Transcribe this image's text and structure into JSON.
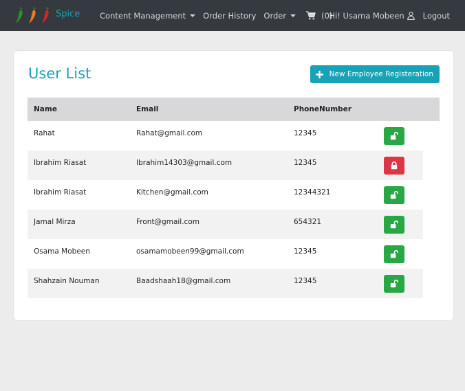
{
  "navbar": {
    "brand": "Spice",
    "items": [
      {
        "label": "Content Management",
        "dropdown": true
      },
      {
        "label": "Order History",
        "dropdown": false
      },
      {
        "label": "Order",
        "dropdown": true
      }
    ],
    "cart_count": "(0)",
    "greeting": "Hi! Usama Mobeen",
    "logout": "Logout"
  },
  "main": {
    "title": "User List",
    "new_button_label": "New Employee Registeration",
    "columns": [
      "Name",
      "Email",
      "PhoneNumber"
    ],
    "rows": [
      {
        "name": "Rahat",
        "email": "Rahat@gmail.com",
        "phone": "12345",
        "locked": false
      },
      {
        "name": "Ibrahim Riasat",
        "email": "Ibrahim14303@gmail.com",
        "phone": "12345",
        "locked": true
      },
      {
        "name": "Ibrahim Riasat",
        "email": "Kitchen@gmail.com",
        "phone": "12344321",
        "locked": false
      },
      {
        "name": "Jamal Mirza",
        "email": "Front@gmail.com",
        "phone": "654321",
        "locked": false
      },
      {
        "name": "Osama Mobeen",
        "email": "osamamobeen99@gmail.com",
        "phone": "12345",
        "locked": false
      },
      {
        "name": "Shahzain Nouman",
        "email": "Baadshaah18@gmail.com",
        "phone": "12345",
        "locked": false
      }
    ]
  },
  "colors": {
    "navbar_bg": "#343a40",
    "accent": "#17a2b8",
    "unlock": "#28a745",
    "lock": "#dc3545"
  },
  "icons": {
    "brand": [
      "chili-green-icon",
      "chili-orange-icon",
      "chili-red-icon"
    ],
    "cart": "shopping-cart-icon",
    "user": "user-icon",
    "add": "plus-icon",
    "unlocked": "lock-open-icon",
    "locked": "lock-icon"
  }
}
